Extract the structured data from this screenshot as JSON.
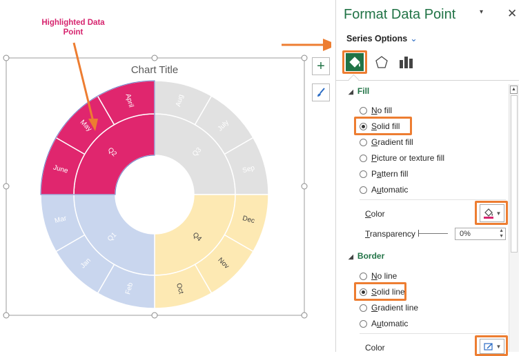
{
  "annotation": {
    "line1": "Highlighted Data",
    "line2": "Point"
  },
  "chart_data": {
    "type": "sunburst",
    "title": "Chart Title",
    "inner_ring": [
      {
        "label": "Q3",
        "value": 3,
        "color": "#e1e1e1"
      },
      {
        "label": "Q4",
        "value": 3,
        "color": "#fde9b3"
      },
      {
        "label": "Q1",
        "value": 3,
        "color": "#c9d6ee"
      },
      {
        "label": "Q2",
        "value": 3,
        "color": "#e0266e"
      }
    ],
    "outer_ring": [
      {
        "label": "Aug",
        "value": 1,
        "color": "#e1e1e1"
      },
      {
        "label": "July",
        "value": 1,
        "color": "#e1e1e1"
      },
      {
        "label": "Sep",
        "value": 1,
        "color": "#e1e1e1"
      },
      {
        "label": "Dec",
        "value": 1,
        "color": "#fde9b3"
      },
      {
        "label": "Nov",
        "value": 1,
        "color": "#fde9b3"
      },
      {
        "label": "Oct",
        "value": 1,
        "color": "#fde9b3"
      },
      {
        "label": "Feb",
        "value": 1,
        "color": "#c9d6ee"
      },
      {
        "label": "Jan",
        "value": 1,
        "color": "#c9d6ee"
      },
      {
        "label": "Mar",
        "value": 1,
        "color": "#c9d6ee"
      },
      {
        "label": "June",
        "value": 1,
        "color": "#e0266e"
      },
      {
        "label": "May",
        "value": 1,
        "color": "#e0266e"
      },
      {
        "label": "April",
        "value": 1,
        "color": "#e0266e"
      }
    ]
  },
  "side_buttons": {
    "add": "+"
  },
  "pane": {
    "title": "Format Data Point",
    "pin": "▾",
    "close": "✕",
    "series_options": "Series Options",
    "series_chevron": "⌄",
    "fill": {
      "heading": "Fill",
      "tri": "◢",
      "options": [
        {
          "pre": "",
          "key": "N",
          "post": "o fill",
          "selected": false
        },
        {
          "pre": "",
          "key": "S",
          "post": "olid fill",
          "selected": true
        },
        {
          "pre": "",
          "key": "G",
          "post": "radient fill",
          "selected": false
        },
        {
          "pre": "",
          "key": "P",
          "post": "icture or texture fill",
          "selected": false
        },
        {
          "pre": "P",
          "key": "a",
          "post": "ttern fill",
          "selected": false
        },
        {
          "pre": "A",
          "key": "u",
          "post": "tomatic",
          "selected": false
        }
      ],
      "color_label_key": "C",
      "color_label_rest": "olor",
      "transparency_key": "T",
      "transparency_rest": "ransparency",
      "transparency_value": "0%"
    },
    "border": {
      "heading": "Border",
      "tri": "◢",
      "options": [
        {
          "pre": "",
          "key": "N",
          "post": "o line",
          "selected": false
        },
        {
          "pre": "",
          "key": "S",
          "post": "olid line",
          "selected": true
        },
        {
          "pre": "",
          "key": "G",
          "post": "radient line",
          "selected": false
        },
        {
          "pre": "A",
          "key": "u",
          "post": "tomatic",
          "selected": false
        }
      ],
      "color_label": "Color"
    }
  },
  "colors": {
    "accent_green": "#217346",
    "callout_orange": "#ed7d31",
    "magenta": "#d6246e"
  }
}
